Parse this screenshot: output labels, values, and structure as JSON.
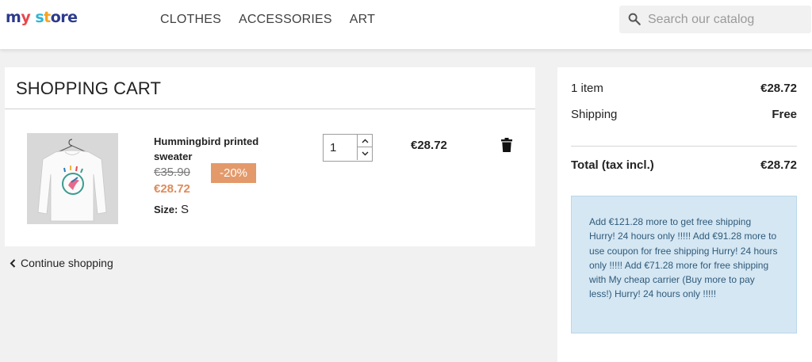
{
  "header": {
    "logo_parts": [
      "m",
      "y",
      " s",
      "t",
      "ore"
    ],
    "nav": [
      "CLOTHES",
      "ACCESSORIES",
      "ART"
    ],
    "search_placeholder": "Search our catalog"
  },
  "cart": {
    "title": "SHOPPING CART",
    "item": {
      "name": "Hummingbird printed sweater",
      "regular_price": "€35.90",
      "discount": "-20%",
      "price": "€28.72",
      "size_label": "Size:",
      "size_value": "S",
      "quantity": "1",
      "line_total": "€28.72"
    },
    "continue_label": "Continue shopping"
  },
  "summary": {
    "items_label": "1 item",
    "items_value": "€28.72",
    "shipping_label": "Shipping",
    "shipping_value": "Free",
    "total_label": "Total (tax incl.)",
    "total_value": "€28.72",
    "notice": "Add €121.28 more to get free shipping Hurry! 24 hours only !!!!! Add €91.28 more to use coupon for free shipping Hurry! 24 hours only !!!!! Add €71.28 more for free shipping with My cheap carrier (Buy more to pay less!) Hurry! 24 hours only !!!!!"
  },
  "colors": {
    "accent": "#e4996a",
    "price": "#e08b5b",
    "notice_bg": "#d5e7f3"
  }
}
